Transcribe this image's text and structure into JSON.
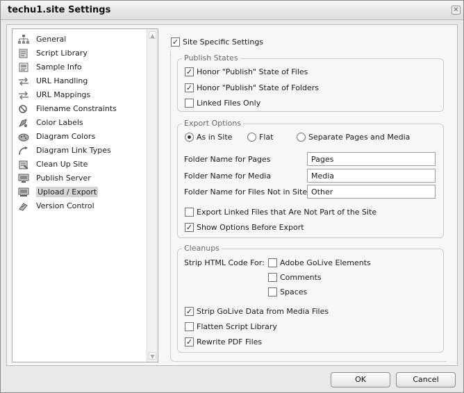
{
  "window": {
    "title": "techu1.site Settings",
    "close_glyph": "✕"
  },
  "sidebar": {
    "items": [
      {
        "label": "General",
        "icon": "sitemap-icon"
      },
      {
        "label": "Script Library",
        "icon": "script-library-icon"
      },
      {
        "label": "Sample Info",
        "icon": "sample-info-icon"
      },
      {
        "label": "URL Handling",
        "icon": "url-handling-icon"
      },
      {
        "label": "URL Mappings",
        "icon": "url-mappings-icon"
      },
      {
        "label": "Filename Constraints",
        "icon": "filename-constraints-icon"
      },
      {
        "label": "Color Labels",
        "icon": "color-labels-icon"
      },
      {
        "label": "Diagram Colors",
        "icon": "diagram-colors-icon"
      },
      {
        "label": "Diagram Link Types",
        "icon": "diagram-link-types-icon"
      },
      {
        "label": "Clean Up Site",
        "icon": "clean-up-site-icon"
      },
      {
        "label": "Publish Server",
        "icon": "publish-server-icon"
      },
      {
        "label": "Upload / Export",
        "icon": "upload-export-icon",
        "selected": true
      },
      {
        "label": "Version Control",
        "icon": "version-control-icon"
      }
    ]
  },
  "site_specific": {
    "label": "Site Specific Settings",
    "checked": true
  },
  "publish_states": {
    "title": "Publish States",
    "honor_files": {
      "label": "Honor \"Publish\" State of Files",
      "checked": true
    },
    "honor_folders": {
      "label": "Honor \"Publish\" State of Folders",
      "checked": true
    },
    "linked_only": {
      "label": "Linked Files Only",
      "checked": false
    }
  },
  "export_options": {
    "title": "Export Options",
    "radios": [
      {
        "label": "As in Site",
        "selected": true
      },
      {
        "label": "Flat",
        "selected": false
      },
      {
        "label": "Separate Pages and Media",
        "selected": false
      }
    ],
    "pages_label": "Folder Name for Pages",
    "pages_value": "Pages",
    "media_label": "Folder Name for Media",
    "media_value": "Media",
    "other_label": "Folder Name for Files Not in Site",
    "other_value": "Other",
    "export_linked": {
      "label": "Export Linked Files that Are Not Part of the Site",
      "checked": false
    },
    "show_options": {
      "label": "Show Options Before Export",
      "checked": true
    }
  },
  "cleanups": {
    "title": "Cleanups",
    "strip_label": "Strip HTML Code For:",
    "golive_elements": {
      "label": "Adobe GoLive Elements",
      "checked": false
    },
    "comments": {
      "label": "Comments",
      "checked": false
    },
    "spaces": {
      "label": "Spaces",
      "checked": false
    },
    "strip_golive_data": {
      "label": "Strip GoLive Data from Media Files",
      "checked": true
    },
    "flatten_script": {
      "label": "Flatten Script Library",
      "checked": false
    },
    "rewrite_pdf": {
      "label": "Rewrite PDF Files",
      "checked": true
    }
  },
  "buttons": {
    "ok": "OK",
    "cancel": "Cancel"
  },
  "check_glyph": "✓"
}
